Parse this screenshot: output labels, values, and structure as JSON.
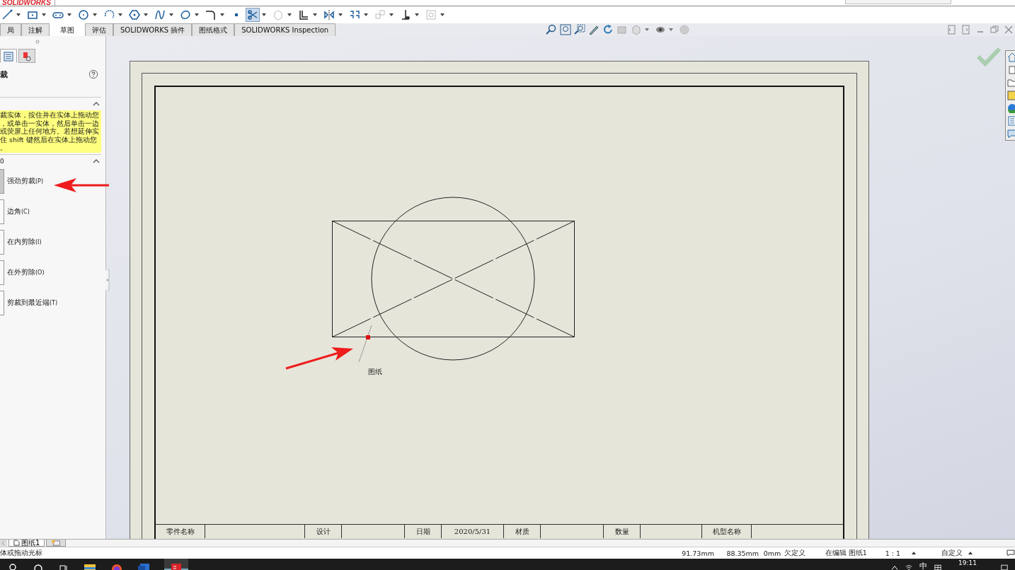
{
  "app": {
    "logo": "SOLIDWORKS"
  },
  "toolbar": [
    {
      "kind": "line",
      "selected": false
    },
    {
      "kind": "rect",
      "selected": false
    },
    {
      "kind": "slot",
      "selected": false
    },
    {
      "kind": "circle",
      "selected": false
    },
    {
      "kind": "arc",
      "selected": false
    },
    {
      "kind": "polygon",
      "selected": false
    },
    {
      "kind": "spline",
      "selected": false
    },
    {
      "kind": "ellipse",
      "selected": false
    },
    {
      "kind": "fillet",
      "selected": false
    },
    {
      "kind": "point",
      "selected": false
    },
    {
      "kind": "trim",
      "selected": true
    },
    {
      "kind": "convert",
      "selected": false
    },
    {
      "kind": "offset",
      "selected": false
    },
    {
      "kind": "mirror",
      "selected": false
    },
    {
      "kind": "pattern",
      "selected": false
    },
    {
      "kind": "move",
      "selected": false
    },
    {
      "kind": "relation",
      "selected": false
    },
    {
      "kind": "repair",
      "selected": false
    }
  ],
  "tabs": [
    {
      "label": "局",
      "selected": false
    },
    {
      "label": "注解",
      "selected": false
    },
    {
      "label": "草图",
      "selected": true
    },
    {
      "label": "评估",
      "selected": false
    },
    {
      "label": "SOLIDWORKS 插件",
      "selected": false
    },
    {
      "label": "图纸格式",
      "selected": false
    },
    {
      "label": "SOLIDWORKS Inspection",
      "selected": false
    }
  ],
  "panel": {
    "tabs": [
      {
        "kind": "tree",
        "selected": true
      },
      {
        "kind": "property",
        "selected": false
      }
    ],
    "title": "裁",
    "message_lines": [
      "裁实体，按住并在实体上拖动您",
      "，或单击一实体，然后单击一边",
      "或荧屏上任何地方。若想延伸实",
      "住 shift 键然后在实体上拖动您",
      "。"
    ],
    "options_header": "0",
    "options": [
      {
        "label": "强劲剪裁",
        "key": "(P)",
        "selected": true
      },
      {
        "label": "边角",
        "key": "(C)",
        "selected": false
      },
      {
        "label": "在内剪除",
        "key": "(I)",
        "selected": false
      },
      {
        "label": "在外剪除",
        "key": "(O)",
        "selected": false
      },
      {
        "label": "剪裁到最近端",
        "key": "(T)",
        "selected": false
      }
    ]
  },
  "sheet": {
    "sketch_label": "图纸",
    "title_block": [
      {
        "label": "零件名称"
      },
      {
        "label": "设计"
      },
      {
        "label": "日期",
        "value": "2020/5/31"
      },
      {
        "label": "材质"
      },
      {
        "label": "数量"
      },
      {
        "label": "机型名称"
      }
    ]
  },
  "sheet_tabs": [
    {
      "label": "图纸1",
      "selected": true
    }
  ],
  "status_bar": {
    "hint": "体或拖动光标",
    "x": "91.73mm",
    "y": "88.35mm",
    "z": "0mm",
    "state": "欠定义",
    "editing": "在编辑 图纸1",
    "scale": "1 : 1",
    "units": "自定义"
  },
  "taskbar": {
    "ime": "中",
    "time": "19:11"
  }
}
